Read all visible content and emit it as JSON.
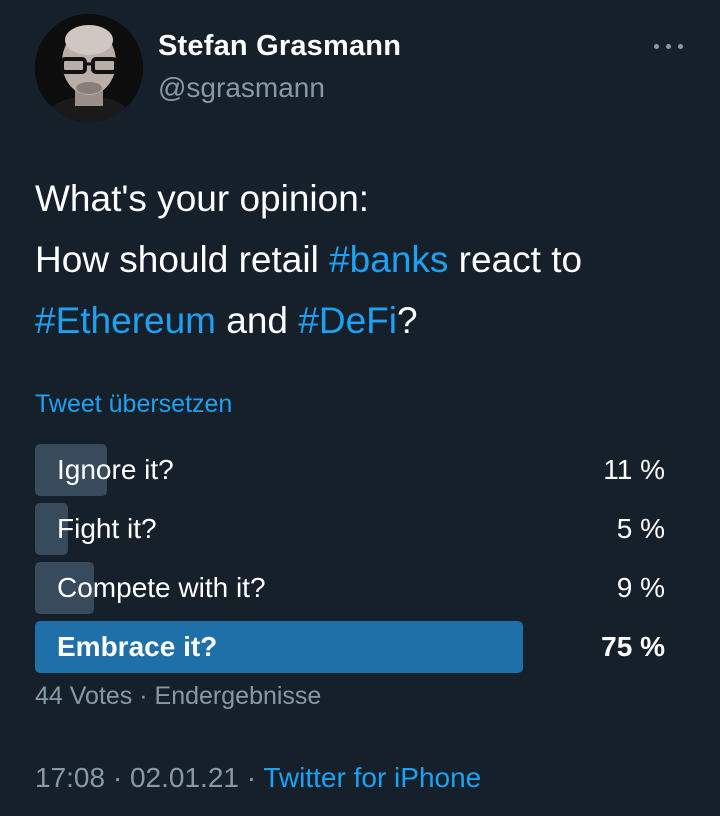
{
  "author": {
    "name": "Stefan Grasmann",
    "handle": "@sgrasmann"
  },
  "tweet": {
    "line1": "What's your opinion:",
    "line2_pre": "How should retail ",
    "line2_tag": "#banks",
    "line2_post": " react to",
    "line3_tag1": "#Ethereum",
    "line3_mid": " and ",
    "line3_tag2": "#DeFi",
    "line3_post": "?"
  },
  "translate_label": "Tweet übersetzen",
  "poll": {
    "options": [
      {
        "label": "Ignore it?",
        "percent_text": "11 %",
        "percent": 11
      },
      {
        "label": "Fight it?",
        "percent_text": "5 %",
        "percent": 5
      },
      {
        "label": "Compete with it?",
        "percent_text": "9 %",
        "percent": 9
      },
      {
        "label": "Embrace it?",
        "percent_text": "75 %",
        "percent": 75
      }
    ],
    "votes": "44 Votes",
    "separator": "·",
    "status": "Endergebnisse"
  },
  "footer": {
    "time": "17:08",
    "sep1": "·",
    "date": "02.01.21",
    "sep2": "·",
    "source": "Twitter for iPhone"
  },
  "colors": {
    "background": "#15202b",
    "link": "#1da1f2",
    "muted": "#8899a6",
    "winner_bar": "#1f6fa8",
    "bar": "#3d5466"
  },
  "icons": {
    "more": "more-horizontal-icon"
  }
}
